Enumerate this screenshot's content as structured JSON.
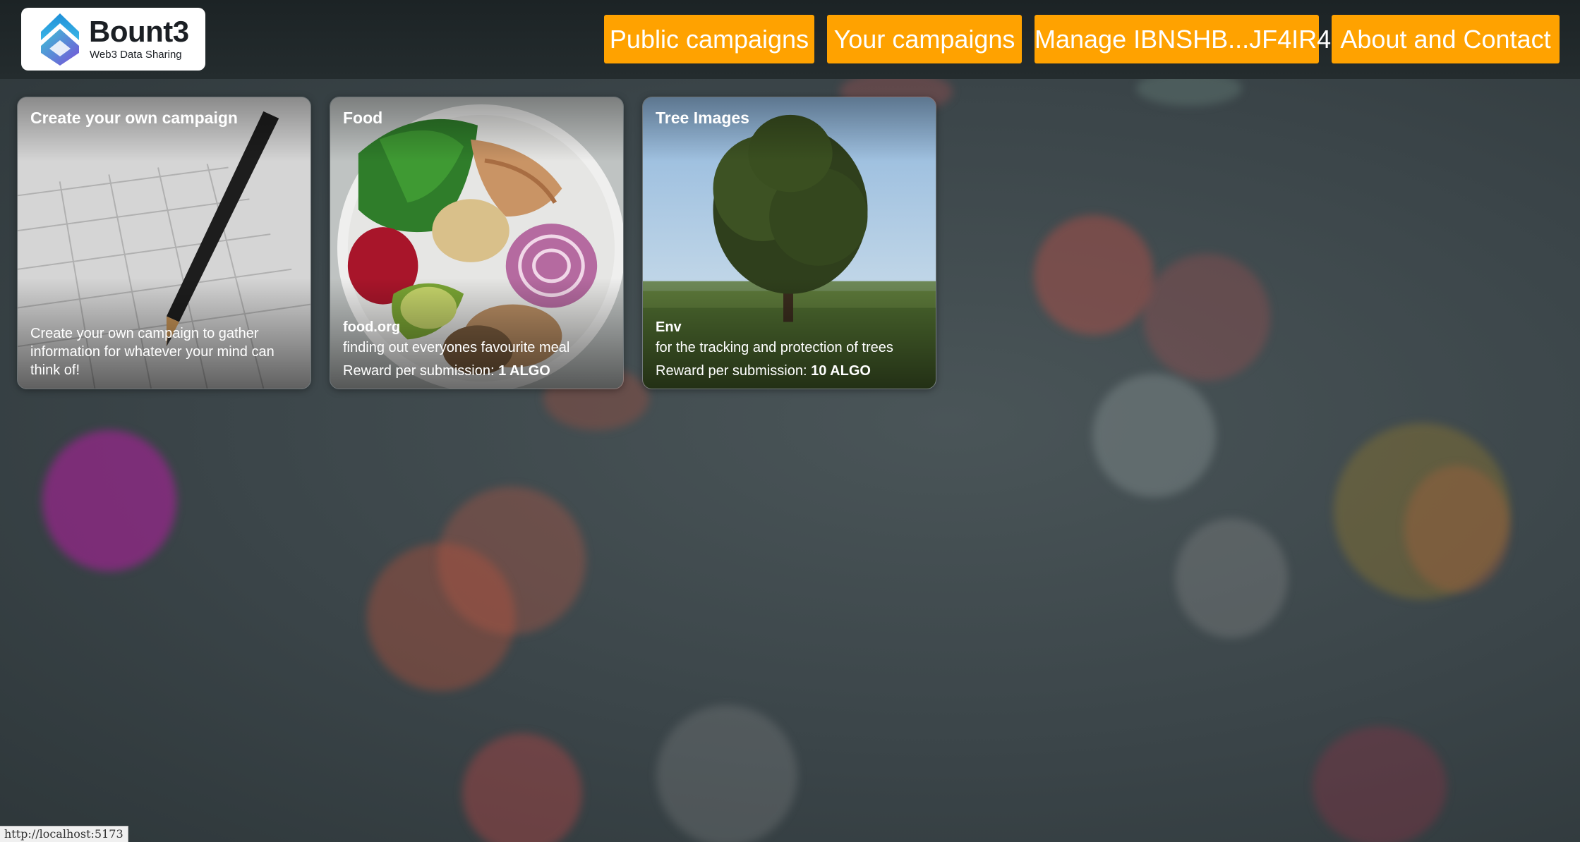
{
  "app": {
    "logo_title": "Bount3",
    "logo_subtitle": "Web3 Data Sharing",
    "logo_icon": "bount3-logo-icon"
  },
  "nav": {
    "public_campaigns": "Public campaigns",
    "your_campaigns": "Your campaigns",
    "manage_account": "Manage IBNSHB...JF4IR4",
    "about_contact": "About and Contact"
  },
  "cards": [
    {
      "title": "Create your own campaign",
      "description": "Create your own campaign to gather information for whatever your mind can think of!"
    },
    {
      "title": "Food",
      "org": "food.org",
      "description": "finding out everyones favourite meal",
      "reward_label": "Reward per submission: ",
      "reward_value": "1 ALGO"
    },
    {
      "title": "Tree Images",
      "org": "Env",
      "description": "for the tracking and protection of trees",
      "reward_label": "Reward per submission: ",
      "reward_value": "10 ALGO"
    }
  ],
  "status_bar": {
    "url": "http://localhost:5173"
  },
  "colors": {
    "accent": "#ffa200",
    "topbar": "#1f2628"
  }
}
